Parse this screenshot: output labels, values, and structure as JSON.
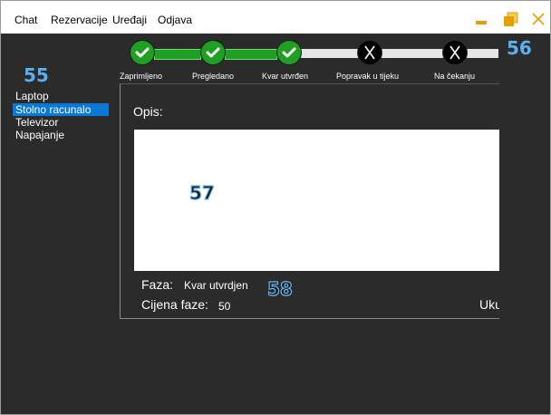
{
  "menu": {
    "items": [
      {
        "label": "Chat"
      },
      {
        "label": "Rezervacije"
      },
      {
        "label": "Uređaji"
      },
      {
        "label": "Odjava"
      }
    ]
  },
  "colors": {
    "titlebar_icons": "#e8a000",
    "step_done": "#1fa023",
    "step_todo": "#000000",
    "selected_item": "#0a78d7",
    "background": "#2b2b2b"
  },
  "markers": {
    "sidebar": "55",
    "header": "56",
    "description": "57",
    "phase": "58"
  },
  "devices": {
    "items": [
      {
        "label": "Laptop",
        "selected": false
      },
      {
        "label": "Stolno racunalo",
        "selected": true
      },
      {
        "label": "Televizor",
        "selected": false
      },
      {
        "label": "Napajanje",
        "selected": false
      }
    ]
  },
  "steps": {
    "items": [
      {
        "label": "Zaprimljeno",
        "status": "done"
      },
      {
        "label": "Pregledano",
        "status": "done"
      },
      {
        "label": "Kvar utvrđen",
        "status": "done"
      },
      {
        "label": "Popravak u  tijeku",
        "status": "pending"
      },
      {
        "label": "Na čekanju",
        "status": "pending"
      }
    ]
  },
  "details": {
    "description_label": "Opis:",
    "description_value": "",
    "phase_label": "Faza:",
    "phase_value": "Kvar utvrdjen",
    "price_label": "Cijena faze:",
    "price_value": "50",
    "total_label": "Uku"
  }
}
